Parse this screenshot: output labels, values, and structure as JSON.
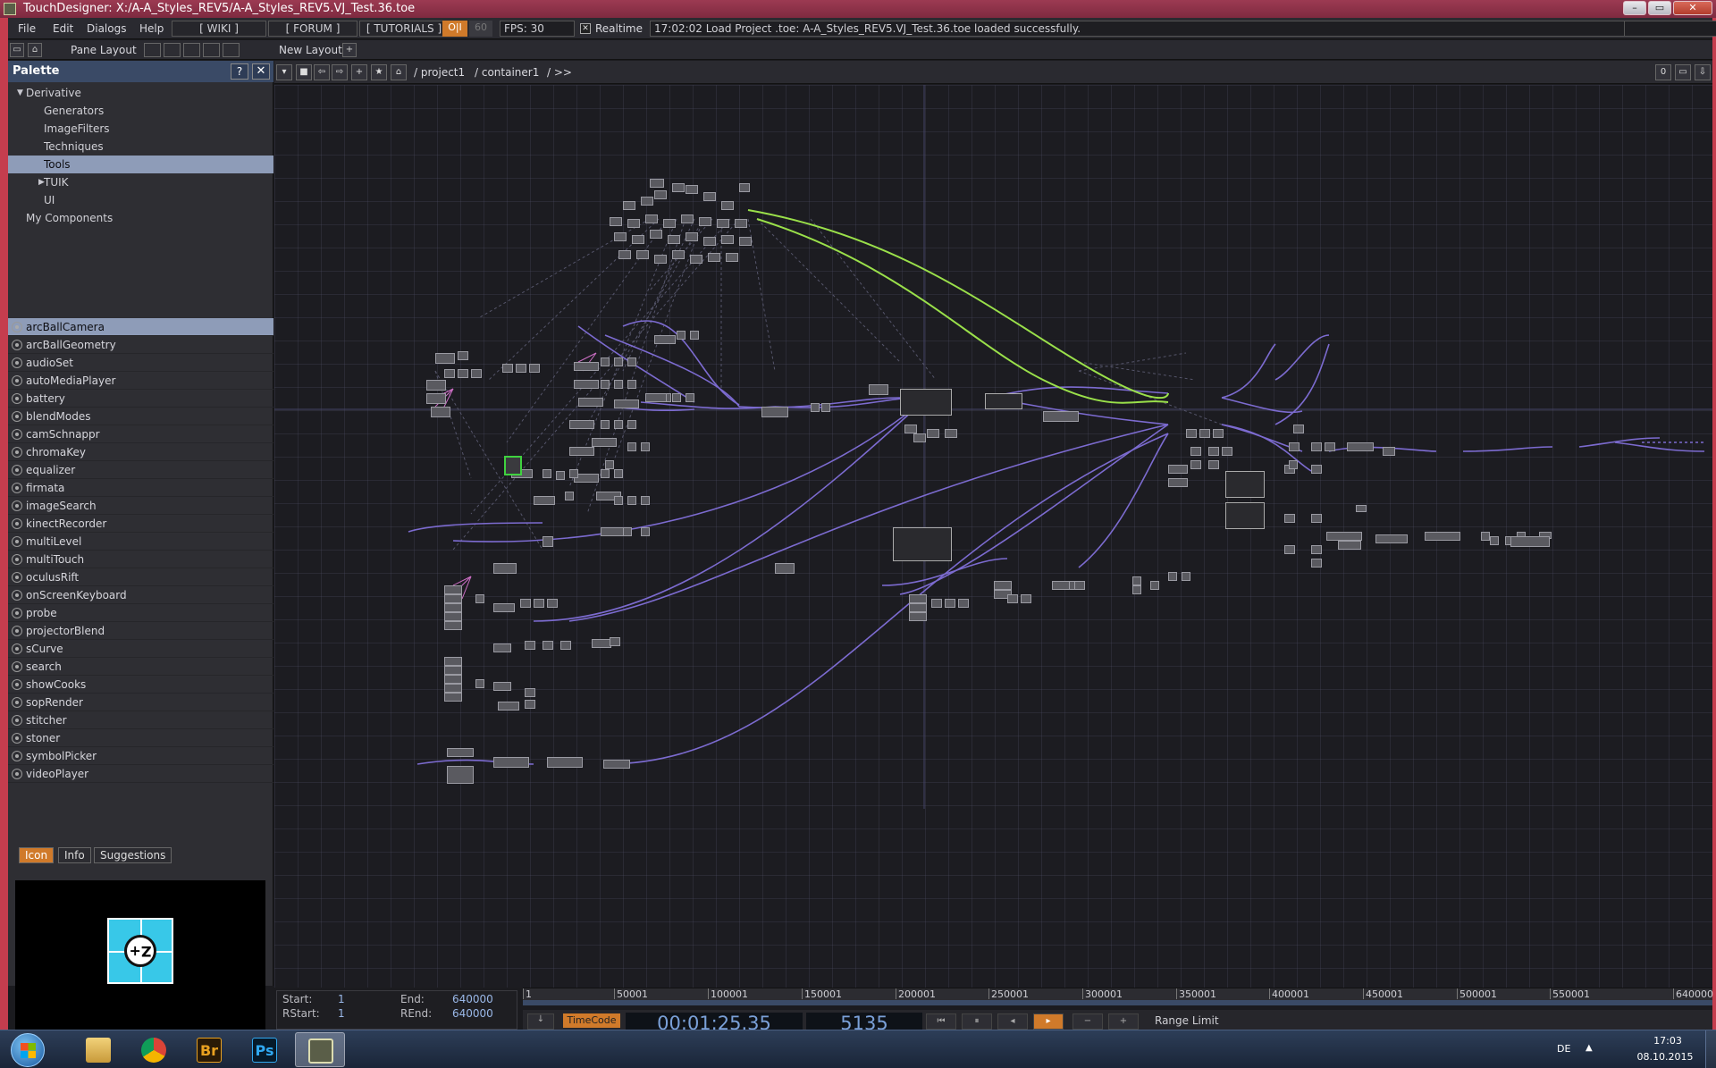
{
  "window": {
    "title": "TouchDesigner: X:/A-A_Styles_REV5/A-A_Styles_REV5.VJ_Test.36.toe",
    "min_label": "–",
    "max_label": "▭",
    "close_label": "✕"
  },
  "menu": {
    "file": "File",
    "edit": "Edit",
    "dialogs": "Dialogs",
    "help": "Help",
    "wiki": "[ WIKI ]",
    "forum": "[ FORUM ]",
    "tutorials": "[ TUTORIALS ]",
    "oi": "O|I",
    "sixty": "60",
    "fps": "FPS:  30",
    "realtime_check": "✕",
    "realtime": "Realtime",
    "status": "17:02:02 Load Project .toe: A-A_Styles_REV5.VJ_Test.36.toe loaded successfully."
  },
  "toolbar2": {
    "pane_layout": "Pane Layout",
    "new_layout": "New Layout",
    "add": "+"
  },
  "palette": {
    "title": "Palette",
    "help": "?",
    "close": "✕",
    "tree": [
      {
        "label": "Derivative",
        "indent": 0,
        "arrow": "▼",
        "selected": false
      },
      {
        "label": "Generators",
        "indent": 2,
        "arrow": "",
        "selected": false
      },
      {
        "label": "ImageFilters",
        "indent": 2,
        "arrow": "",
        "selected": false
      },
      {
        "label": "Techniques",
        "indent": 2,
        "arrow": "",
        "selected": false
      },
      {
        "label": "Tools",
        "indent": 2,
        "arrow": "",
        "selected": true
      },
      {
        "label": "TUIK",
        "indent": 2,
        "arrow": "▶",
        "selected": false
      },
      {
        "label": "UI",
        "indent": 2,
        "arrow": "",
        "selected": false
      },
      {
        "label": "My Components",
        "indent": 1,
        "arrow": "",
        "selected": false
      }
    ],
    "components": [
      "arcBallCamera",
      "arcBallGeometry",
      "audioSet",
      "autoMediaPlayer",
      "battery",
      "blendModes",
      "camSchnappr",
      "chromaKey",
      "equalizer",
      "firmata",
      "imageSearch",
      "kinectRecorder",
      "multiLevel",
      "multiTouch",
      "oculusRift",
      "onScreenKeyboard",
      "probe",
      "projectorBlend",
      "sCurve",
      "search",
      "showCooks",
      "sopRender",
      "stitcher",
      "stoner",
      "symbolPicker",
      "videoPlayer"
    ],
    "selected_component": 0,
    "tabs": {
      "icon": "Icon",
      "info": "Info",
      "suggestions": "Suggestions"
    },
    "preview_glyph": "Z+"
  },
  "network": {
    "path_root": "/ project1",
    "path_child": "/ container1",
    "path_more": "/ >>",
    "right_zero": "0"
  },
  "timeline": {
    "ticks": [
      "1",
      "50001",
      "100001",
      "150001",
      "200001",
      "250001",
      "300001",
      "350001",
      "400001",
      "450001",
      "500001",
      "550001",
      "640000"
    ],
    "start_label": "Start:",
    "start_value": "1",
    "end_label": "End:",
    "end_value": "640000",
    "rstart_label": "RStart:",
    "rstart_value": "1",
    "rend_label": "REnd:",
    "rend_value": "640000",
    "timecode_label": "TimeCode",
    "timecode_value": "00:01:25.35",
    "frame_value": "5135",
    "range_limit": "Range Limit"
  },
  "taskbar": {
    "br": "Br",
    "ps": "Ps",
    "lang": "DE",
    "time": "17:03",
    "date": "08.10.2015"
  },
  "colors": {
    "frame_red": "#c53d4e",
    "accent_orange": "#d07a2a",
    "palette_header": "#3a4a66",
    "selection": "#8e9cb8",
    "wire_purple": "#7c6bd0",
    "wire_green": "#9ae04a"
  }
}
